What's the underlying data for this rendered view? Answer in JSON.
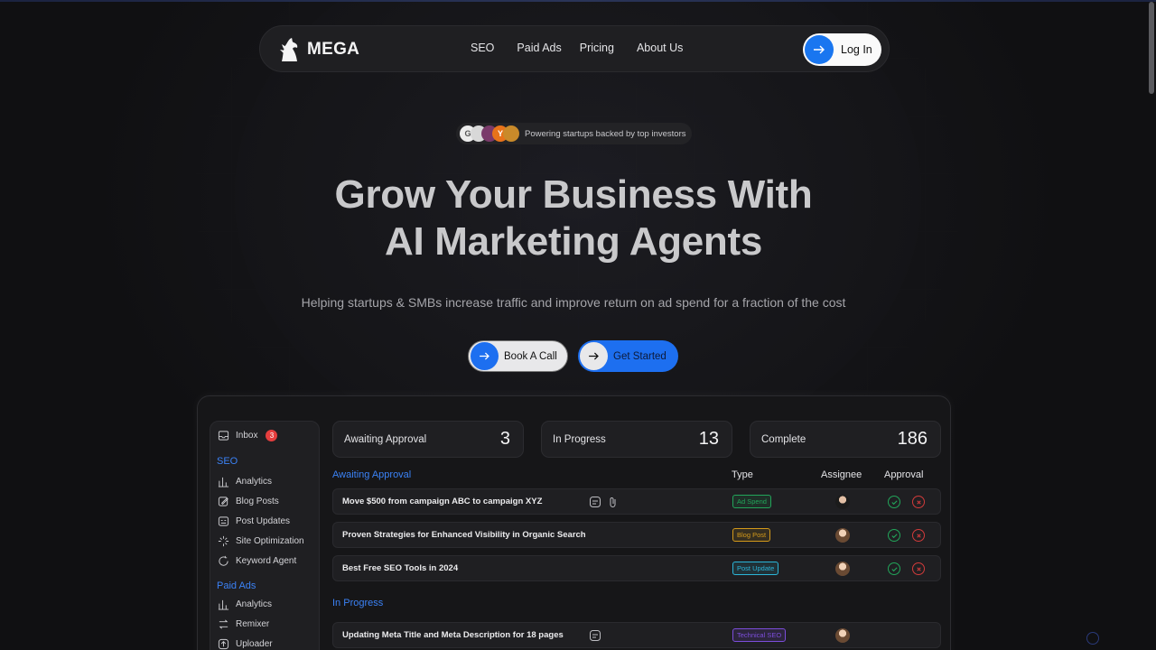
{
  "brand": {
    "name": "MEGA"
  },
  "nav": {
    "links": [
      "SEO",
      "Paid Ads",
      "Pricing",
      "About Us"
    ],
    "login_label": "Log In"
  },
  "investors": {
    "text": "Powering startups backed by top investors",
    "logos": [
      "G",
      "Y"
    ]
  },
  "hero": {
    "title_line1": "Grow Your Business With",
    "title_line2": "AI Marketing Agents",
    "subtitle": "Helping startups & SMBs increase traffic and improve return on ad spend for a fraction of the cost"
  },
  "cta": {
    "book": "Book A Call",
    "start": "Get Started"
  },
  "dashboard": {
    "sidebar": {
      "inbox_label": "Inbox",
      "inbox_count": "3",
      "seo_heading": "SEO",
      "seo_items": [
        "Analytics",
        "Blog Posts",
        "Post Updates",
        "Site Optimization",
        "Keyword Agent"
      ],
      "ads_heading": "Paid Ads",
      "ads_items": [
        "Analytics",
        "Remixer",
        "Uploader"
      ]
    },
    "stats": [
      {
        "label": "Awaiting Approval",
        "value": "3"
      },
      {
        "label": "In Progress",
        "value": "13"
      },
      {
        "label": "Complete",
        "value": "186"
      }
    ],
    "columns": {
      "type": "Type",
      "assignee": "Assignee",
      "approval": "Approval"
    },
    "awaiting_title": "Awaiting Approval",
    "awaiting_rows": [
      {
        "title": "Move $500  from campaign ABC to campaign XYZ",
        "tag": "Ad Spend",
        "tag_color": "#22a55a"
      },
      {
        "title": "Proven Strategies for Enhanced Visibility in Organic Search",
        "tag": "Blog Post",
        "tag_color": "#d49a1a"
      },
      {
        "title": "Best Free SEO Tools in 2024",
        "tag": "Post Update",
        "tag_color": "#2bb5d8"
      }
    ],
    "progress_title": "In Progress",
    "progress_rows": [
      {
        "title": "Updating Meta Title and Meta Description for 18 pages",
        "tag": "Technical SEO",
        "tag_color": "#7c4ddb"
      }
    ]
  },
  "colors": {
    "accent": "#1d6ff0",
    "section": "#3b82f6"
  }
}
